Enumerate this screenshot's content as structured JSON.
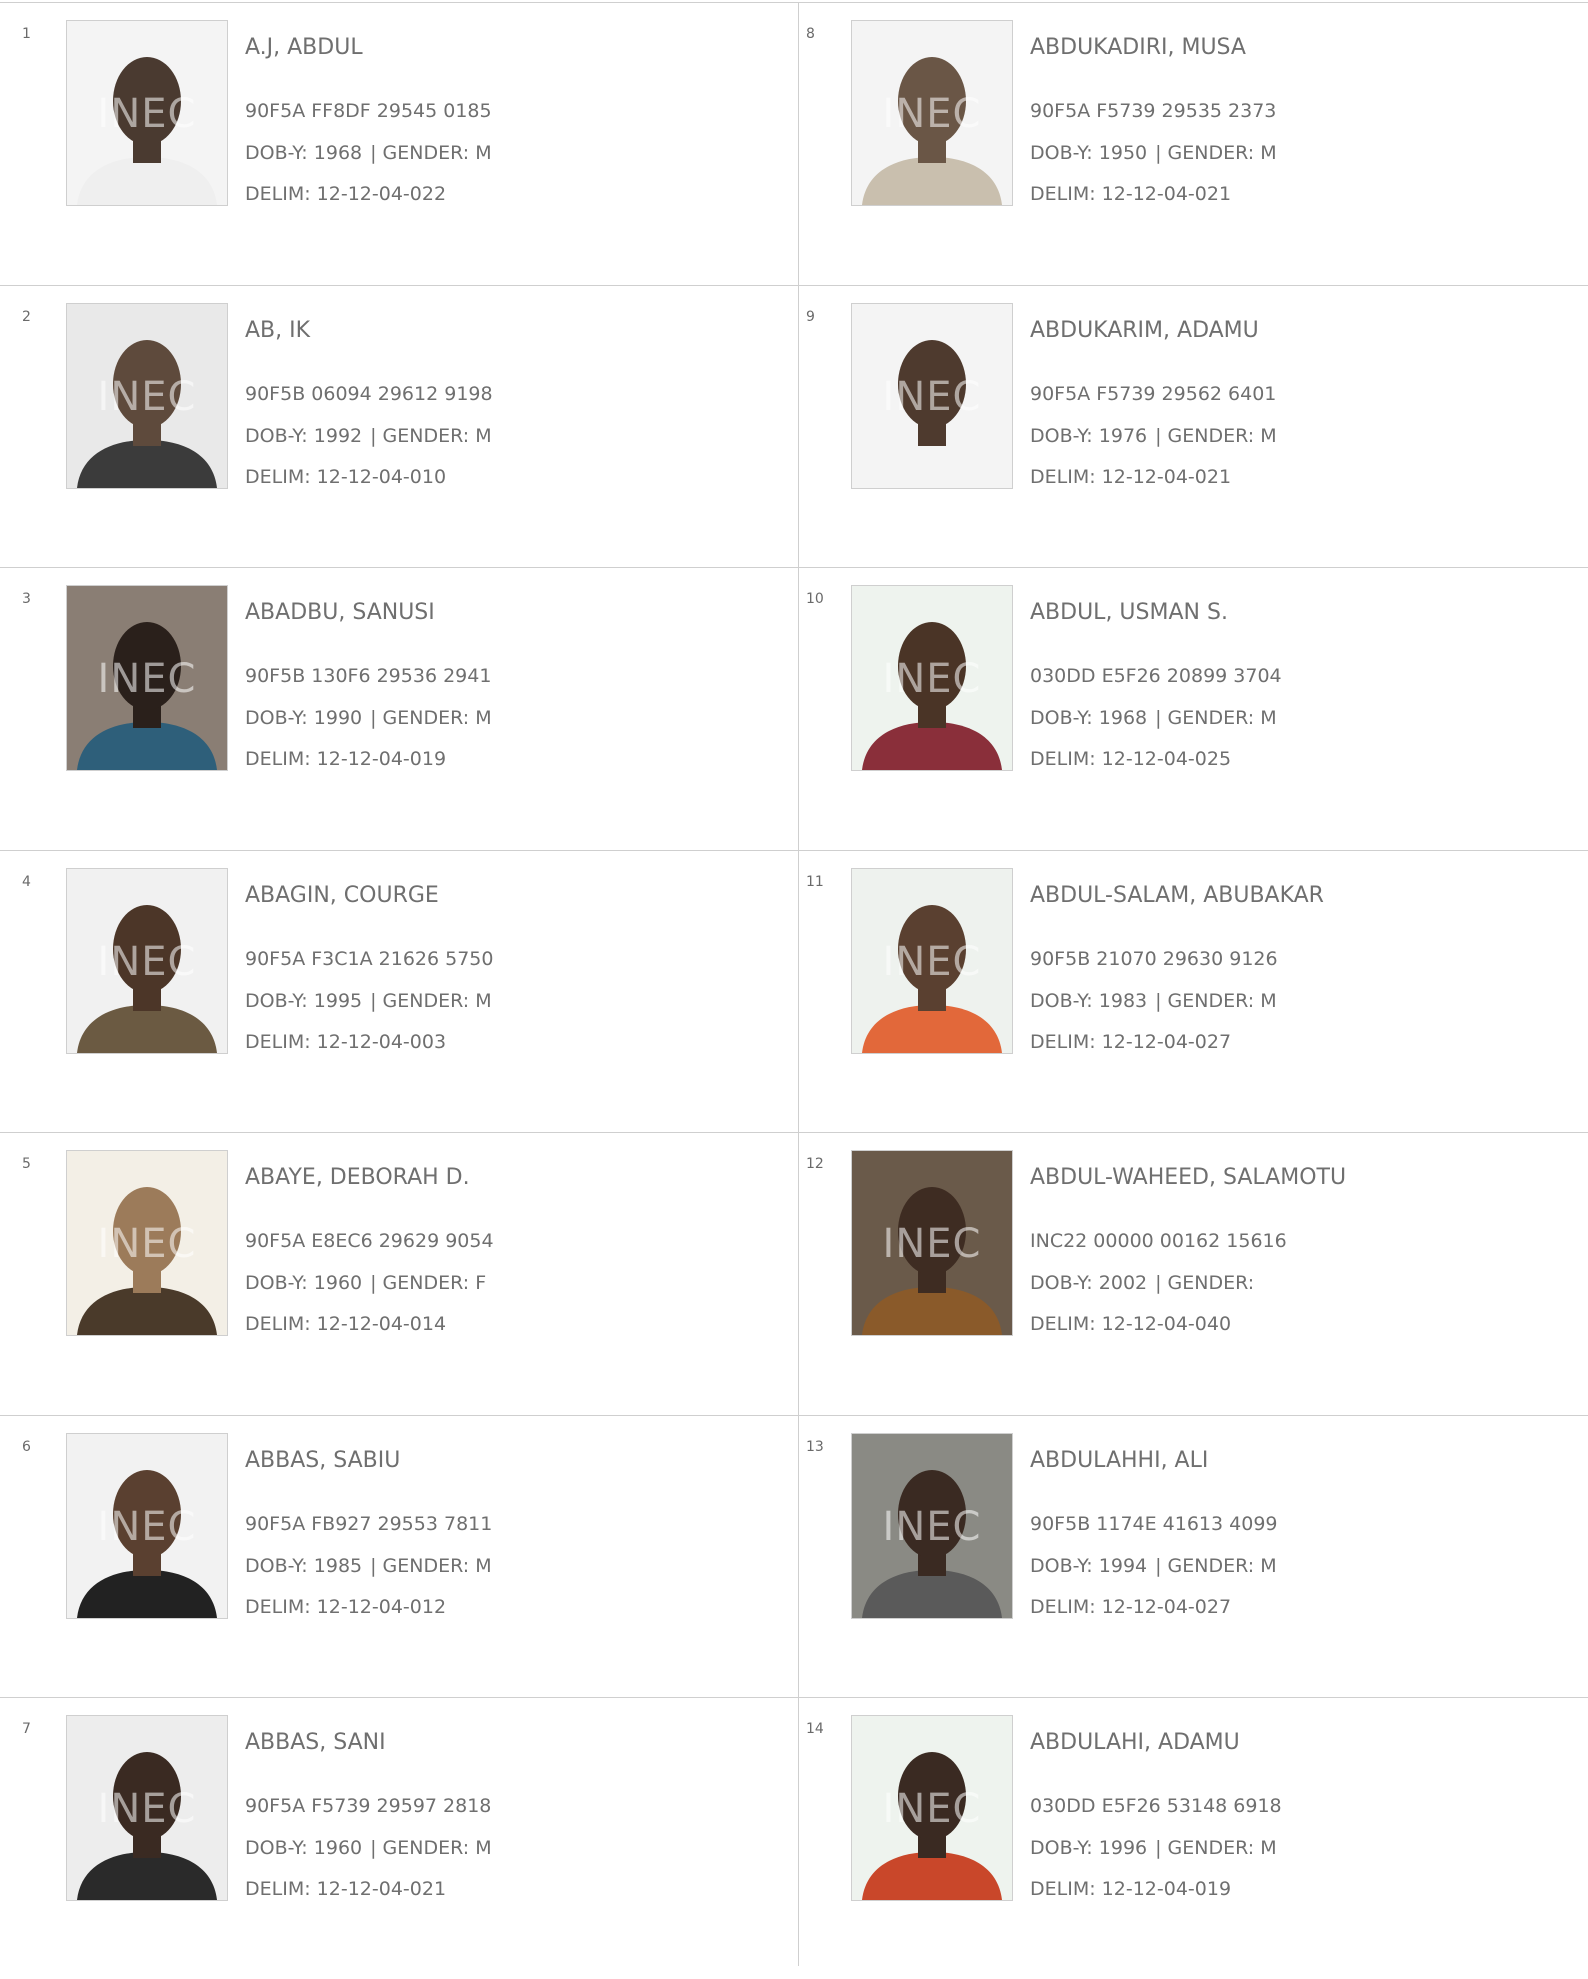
{
  "labels": {
    "dob_prefix": "DOB-Y:",
    "gender_prefix": "GENDER:",
    "delim_prefix": "DELIM:",
    "separator": "|"
  },
  "photo_watermark": "INEC",
  "left_column": [
    {
      "number": "1",
      "name": "A.J, ABDUL",
      "vin": "90F5A FF8DF 29545 0185",
      "dob_year": "1968",
      "gender": "M",
      "delim": "12-12-04-022",
      "photo": {
        "bg": "#f4f4f4",
        "skin": "#4a3a30",
        "shirt": "#efefef"
      }
    },
    {
      "number": "2",
      "name": "AB, IK",
      "vin": "90F5B 06094 29612 9198",
      "dob_year": "1992",
      "gender": "M",
      "delim": "12-12-04-010",
      "photo": {
        "bg": "#e9e9e9",
        "skin": "#5e4a3c",
        "shirt": "#3b3b3b"
      }
    },
    {
      "number": "3",
      "name": "ABADBU, SANUSI",
      "vin": "90F5B 130F6 29536 2941",
      "dob_year": "1990",
      "gender": "M",
      "delim": "12-12-04-019",
      "photo": {
        "bg": "#8a7e74",
        "skin": "#2a201b",
        "shirt": "#2e5f7a"
      }
    },
    {
      "number": "4",
      "name": "ABAGIN, COURGE",
      "vin": "90F5A F3C1A 21626 5750",
      "dob_year": "1995",
      "gender": "M",
      "delim": "12-12-04-003",
      "photo": {
        "bg": "#f1f1f1",
        "skin": "#4c3628",
        "shirt": "#6b5a42"
      }
    },
    {
      "number": "5",
      "name": "ABAYE, DEBORAH D.",
      "vin": "90F5A E8EC6 29629 9054",
      "dob_year": "1960",
      "gender": "F",
      "delim": "12-12-04-014",
      "photo": {
        "bg": "#f3efe6",
        "skin": "#9c7b5a",
        "shirt": "#4a3a2a"
      }
    },
    {
      "number": "6",
      "name": "ABBAS, SABIU",
      "vin": "90F5A FB927 29553 7811",
      "dob_year": "1985",
      "gender": "M",
      "delim": "12-12-04-012",
      "photo": {
        "bg": "#f2f2f2",
        "skin": "#5a4030",
        "shirt": "#222222"
      }
    },
    {
      "number": "7",
      "name": "ABBAS, SANI",
      "vin": "90F5A F5739 29597 2818",
      "dob_year": "1960",
      "gender": "M",
      "delim": "12-12-04-021",
      "photo": {
        "bg": "#ededed",
        "skin": "#3a2a22",
        "shirt": "#2a2a2a"
      }
    }
  ],
  "right_column": [
    {
      "number": "8",
      "name": "ABDUKADIRI, MUSA",
      "vin": "90F5A F5739 29535 2373",
      "dob_year": "1950",
      "gender": "M",
      "delim": "12-12-04-021",
      "photo": {
        "bg": "#f4f4f4",
        "skin": "#6a5646",
        "shirt": "#c9bfae"
      }
    },
    {
      "number": "9",
      "name": "ABDUKARIM, ADAMU",
      "vin": "90F5A F5739 29562 6401",
      "dob_year": "1976",
      "gender": "M",
      "delim": "12-12-04-021",
      "photo": {
        "bg": "#f4f4f4",
        "skin": "#4e3a2e",
        "shirt": "#f4f4f4"
      }
    },
    {
      "number": "10",
      "name": "ABDUL, USMAN S.",
      "vin": "030DD E5F26 20899 3704",
      "dob_year": "1968",
      "gender": "M",
      "delim": "12-12-04-025",
      "photo": {
        "bg": "#eef3ee",
        "skin": "#4a3426",
        "shirt": "#8a2f3a"
      }
    },
    {
      "number": "11",
      "name": "ABDUL-SALAM, ABUBAKAR",
      "vin": "90F5B 21070 29630 9126",
      "dob_year": "1983",
      "gender": "M",
      "delim": "12-12-04-027",
      "photo": {
        "bg": "#eef2ee",
        "skin": "#5a4030",
        "shirt": "#e2683a"
      }
    },
    {
      "number": "12",
      "name": "ABDUL-WAHEED, SALAMOTU",
      "vin": "INC22 00000 00162 15616",
      "dob_year": "2002",
      "gender": "",
      "delim": "12-12-04-040",
      "photo": {
        "bg": "#6a5a4a",
        "skin": "#3e2c22",
        "shirt": "#8a5a2a"
      }
    },
    {
      "number": "13",
      "name": "ABDULAHHI, ALI",
      "vin": "90F5B 1174E 41613 4099",
      "dob_year": "1994",
      "gender": "M",
      "delim": "12-12-04-027",
      "photo": {
        "bg": "#8a8a84",
        "skin": "#3a2a22",
        "shirt": "#5a5a5a"
      }
    },
    {
      "number": "14",
      "name": "ABDULAHI, ADAMU",
      "vin": "030DD E5F26 53148 6918",
      "dob_year": "1996",
      "gender": "M",
      "delim": "12-12-04-019",
      "photo": {
        "bg": "#eef3ee",
        "skin": "#3a2a22",
        "shirt": "#c9472a"
      }
    }
  ]
}
